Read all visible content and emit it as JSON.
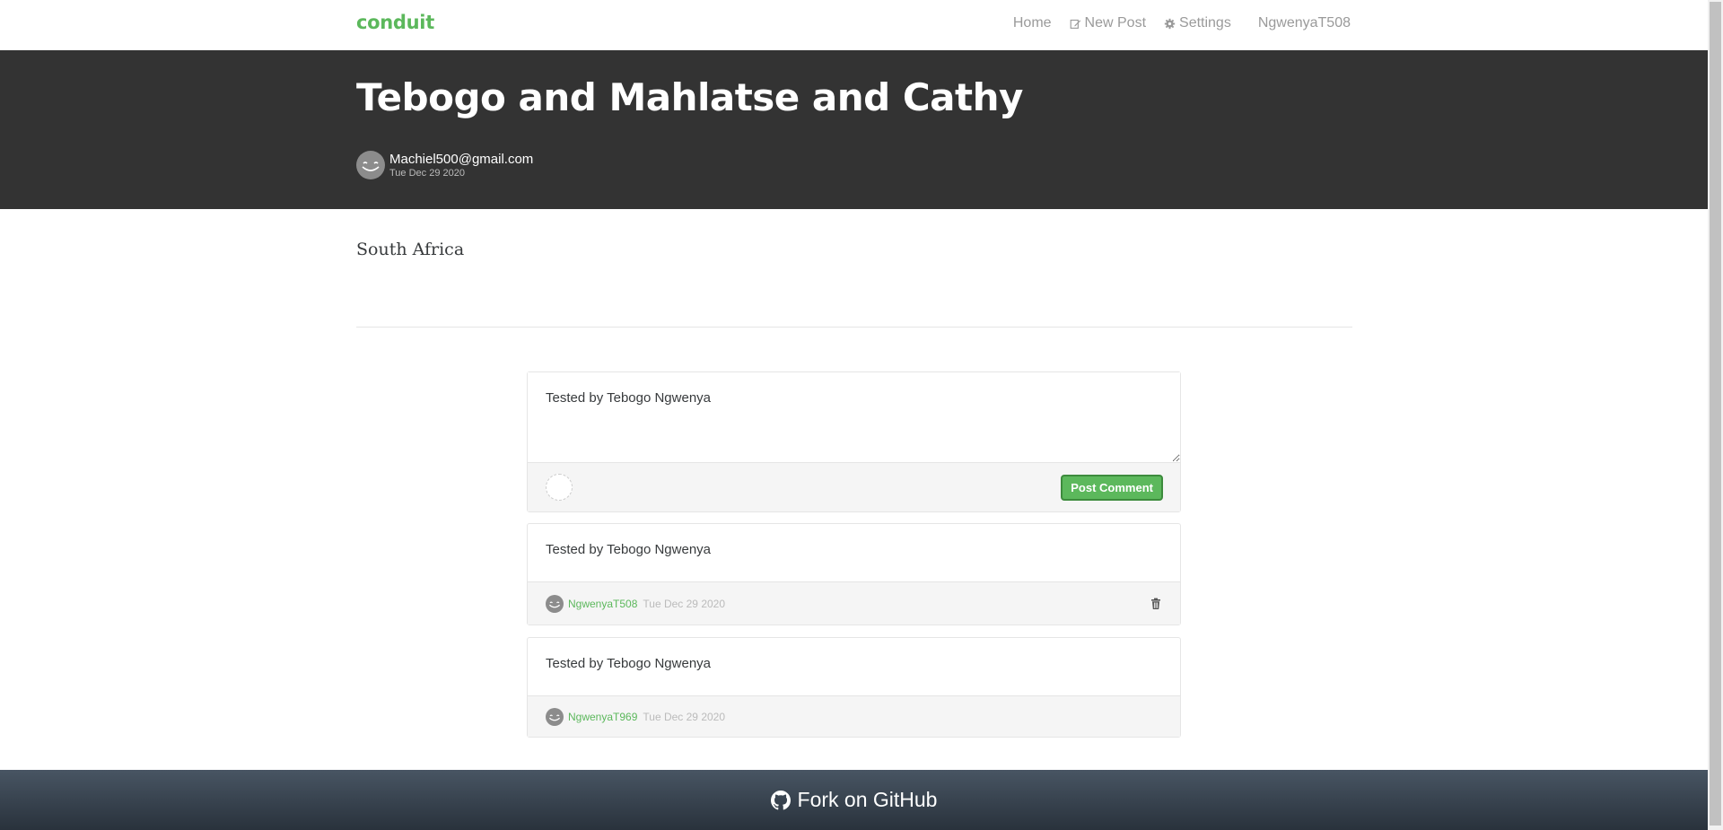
{
  "nav": {
    "brand": "conduit",
    "home": "Home",
    "new_post": "New Post",
    "settings": "Settings",
    "username": "NgwenyaT508"
  },
  "article": {
    "title": "Tebogo and Mahlatse and Cathy",
    "author": "Machiel500@gmail.com",
    "date": "Tue Dec 29 2020",
    "body": "South Africa"
  },
  "comment_form": {
    "value": "Tested by Tebogo Ngwenya",
    "submit_label": "Post Comment"
  },
  "comments": [
    {
      "body": "Tested by Tebogo Ngwenya",
      "author": "NgwenyaT508",
      "date": "Tue Dec 29 2020",
      "deletable": true
    },
    {
      "body": "Tested by Tebogo Ngwenya",
      "author": "NgwenyaT969",
      "date": "Tue Dec 29 2020",
      "deletable": false
    }
  ],
  "footer": {
    "label": "Fork on GitHub"
  },
  "colors": {
    "brand": "#5cb85c",
    "banner": "#333333"
  }
}
